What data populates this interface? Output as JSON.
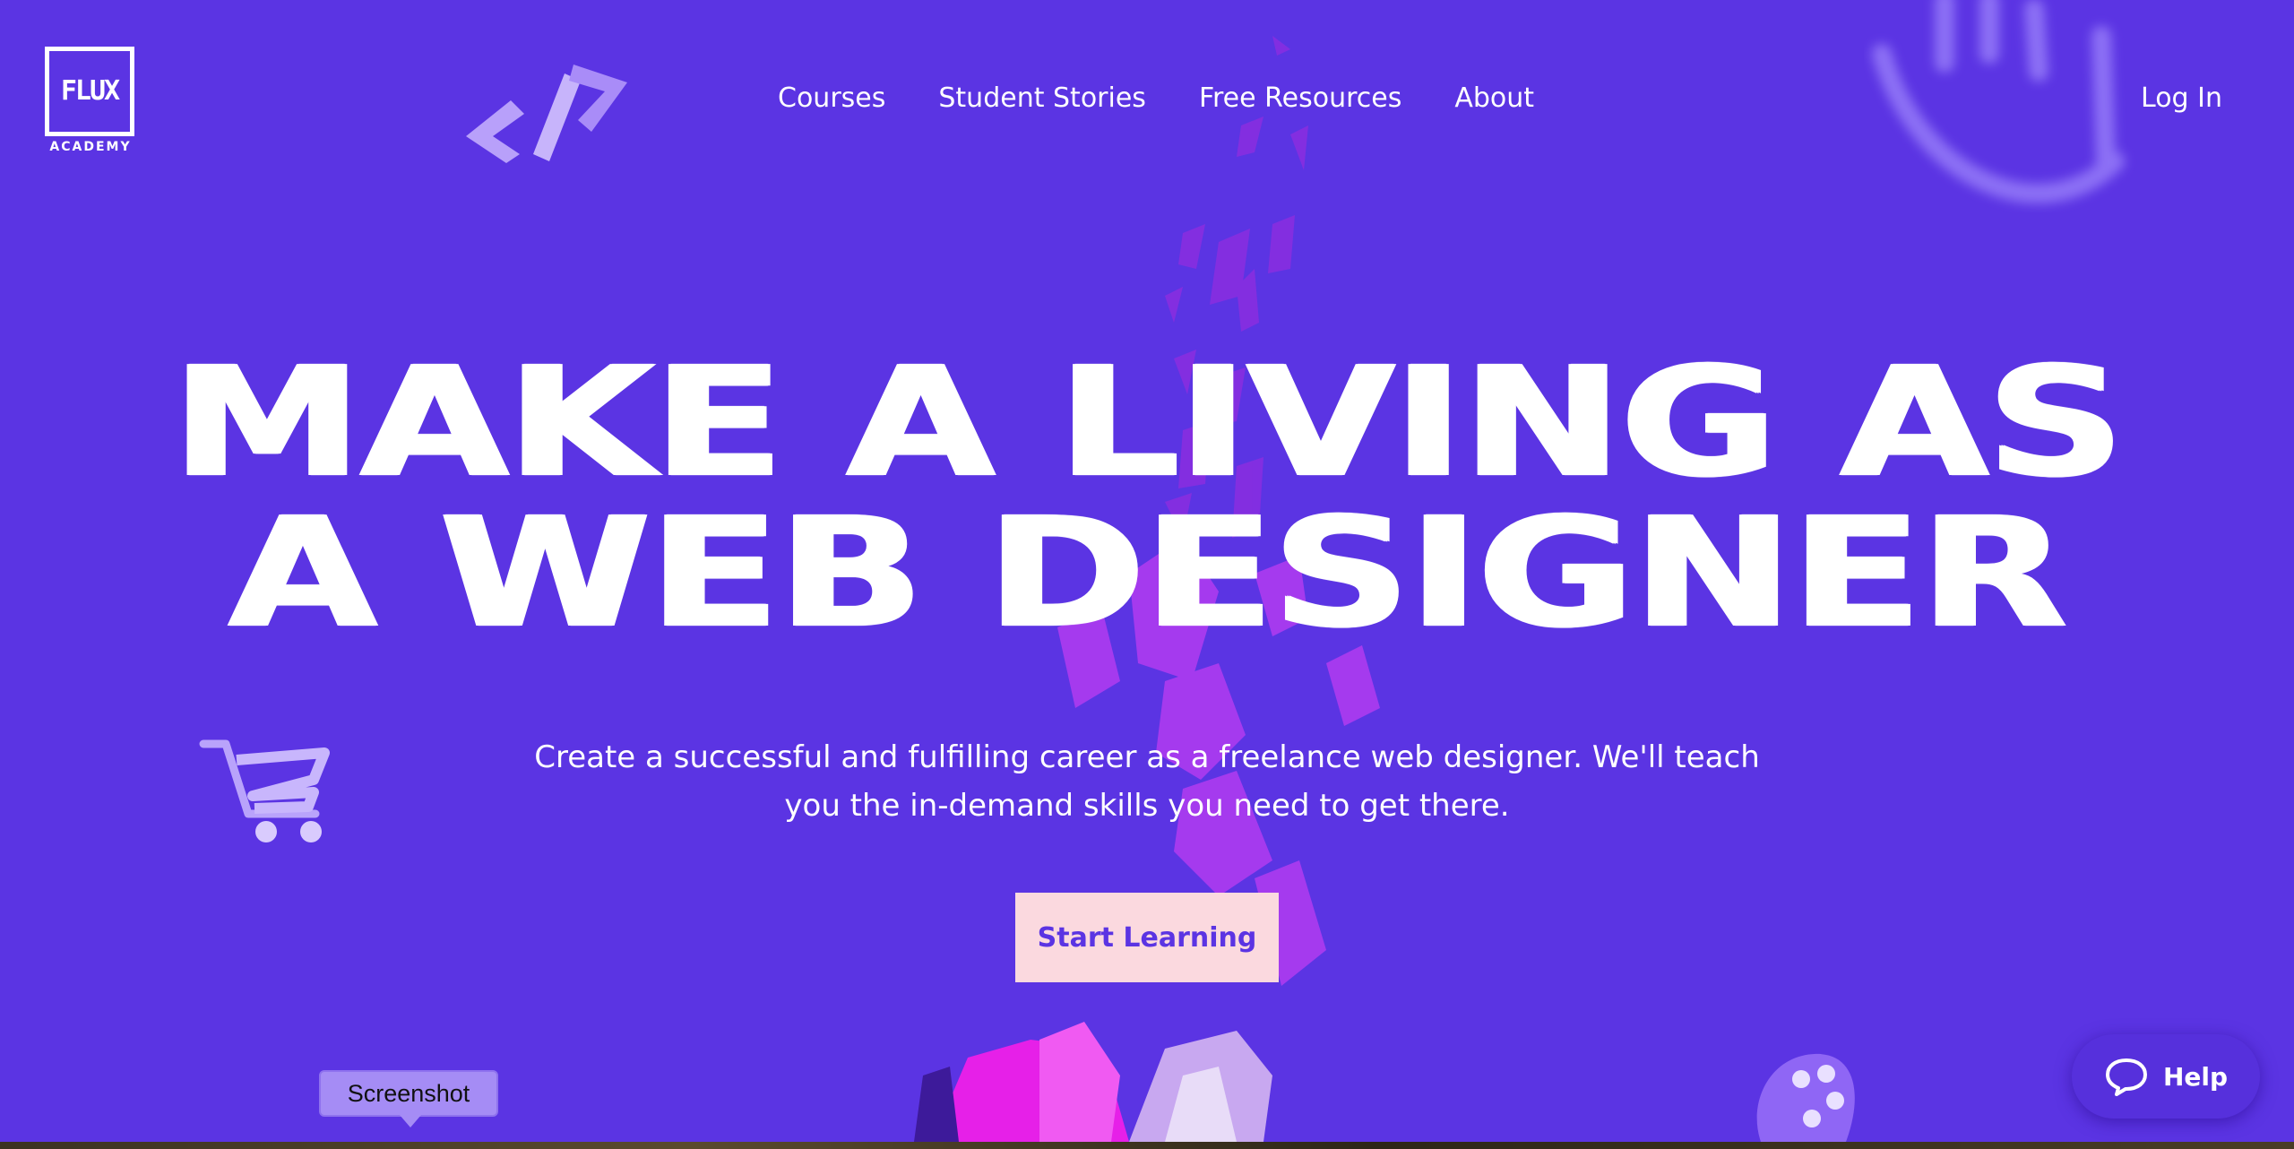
{
  "logo": {
    "letters": "FLUX",
    "sub": "ACADEMY"
  },
  "nav": {
    "items": [
      {
        "label": "Courses"
      },
      {
        "label": "Student Stories"
      },
      {
        "label": "Free Resources"
      },
      {
        "label": "About"
      }
    ],
    "login": "Log In"
  },
  "hero": {
    "headline_line1": "MAKE A LIVING AS",
    "headline_line2": "A WEB DESIGNER",
    "subhead": "Create a successful and fulfilling career as a freelance web designer. We'll teach you the in-demand skills you need to get there.",
    "cta": "Start Learning"
  },
  "tooltip": "Screenshot",
  "help": {
    "label": "Help",
    "icon": "chat-bubble-icon"
  },
  "colors": {
    "background": "#5b34e3",
    "cta_bg": "#fbd9df",
    "cta_text": "#5b34e3",
    "crystal": "#d23cf0"
  }
}
